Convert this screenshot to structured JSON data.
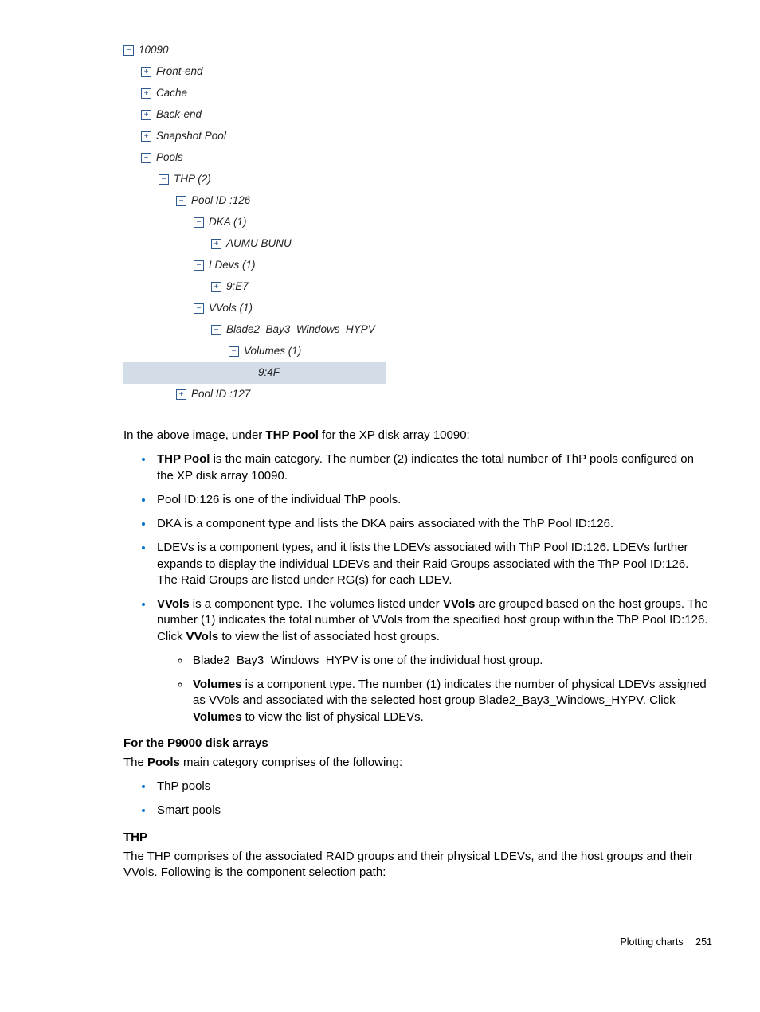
{
  "tree": {
    "root": "10090",
    "items": [
      "Front-end",
      "Cache",
      "Back-end",
      "Snapshot Pool",
      "Pools"
    ],
    "thp": "THP (2)",
    "pool126": "Pool ID :126",
    "dka": "DKA (1)",
    "aumu": "AUMU BUNU",
    "ldevs": "LDevs (1)",
    "ldev1": "9:E7",
    "vvols": "VVols (1)",
    "hostgroup": "Blade2_Bay3_Windows_HYPV",
    "volumes": "Volumes (1)",
    "vol1": "9:4F",
    "pool127": "Pool ID :127"
  },
  "body": {
    "intro_pre": "In the above image, under ",
    "intro_bold": "THP Pool",
    "intro_post": " for the XP disk array 10090:",
    "b1_bold": "THP Pool",
    "b1_rest": " is the main category. The number (2) indicates the total number of ThP pools configured on the XP disk array 10090.",
    "b2": "Pool ID:126 is one of the individual ThP pools.",
    "b3": "DKA is a component type and lists the DKA pairs associated with the ThP Pool ID:126.",
    "b4": "LDEVs is a component types, and it lists the LDEVs associated with ThP Pool ID:126. LDEVs further expands to display the individual LDEVs and their Raid Groups associated with the ThP Pool ID:126. The Raid Groups are listed under RG(s) for each LDEV.",
    "b5_bold1": "VVols",
    "b5_t1": " is a component type. The volumes listed under ",
    "b5_bold2": "VVols",
    "b5_t2": " are grouped based on the host groups. The number (1) indicates the total number of VVols from the specified host group within the ThP Pool ID:126. Click ",
    "b5_bold3": "VVols",
    "b5_t3": " to view the list of associated host groups.",
    "s1": "Blade2_Bay3_Windows_HYPV is one of the individual host group.",
    "s2_bold1": "Volumes",
    "s2_t1": " is a component type. The number (1) indicates the number of physical LDEVs assigned as VVols and associated with the selected host group Blade2_Bay3_Windows_HYPV. Click ",
    "s2_bold2": "Volumes",
    "s2_t2": " to view the list of physical LDEVs.",
    "h1": "For the P9000 disk arrays",
    "p1_pre": "The ",
    "p1_bold": "Pools",
    "p1_post": " main category comprises of the following:",
    "pb1": "ThP pools",
    "pb2": "Smart pools",
    "h2": "THP",
    "p2": "The THP comprises of the associated RAID groups and their physical LDEVs, and the host groups and their VVols. Following is the component selection path:"
  },
  "footer": {
    "section": "Plotting charts",
    "page": "251"
  }
}
